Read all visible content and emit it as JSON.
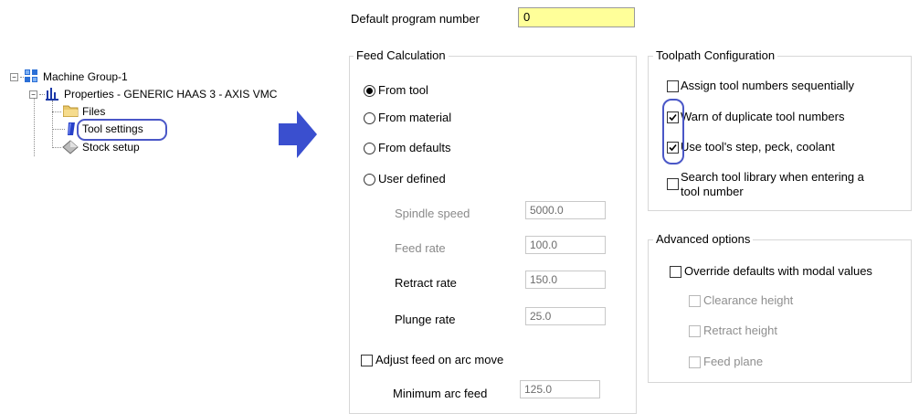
{
  "tree": {
    "machine_group": "Machine Group-1",
    "properties": "Properties - GENERIC HAAS 3 - AXIS VMC",
    "files": "Files",
    "tool_settings": "Tool settings",
    "stock_setup": "Stock setup"
  },
  "default_program": {
    "label": "Default program number",
    "value": "0"
  },
  "feed_calc": {
    "title": "Feed Calculation",
    "options": [
      "From tool",
      "From material",
      "From defaults",
      "User defined"
    ],
    "selected": "From tool",
    "spindle_speed": {
      "label": "Spindle speed",
      "value": "5000.0"
    },
    "feed_rate": {
      "label": "Feed rate",
      "value": "100.0"
    },
    "retract_rate": {
      "label": "Retract rate",
      "value": "150.0"
    },
    "plunge_rate": {
      "label": "Plunge rate",
      "value": "25.0"
    },
    "adjust_feed_arc": {
      "label": "Adjust feed on arc move",
      "checked": false
    },
    "min_arc_feed": {
      "label": "Minimum arc feed",
      "value": "125.0"
    }
  },
  "toolpath_config": {
    "title": "Toolpath Configuration",
    "assign_seq": {
      "label": "Assign tool numbers sequentially",
      "checked": false
    },
    "warn_dup": {
      "label": "Warn of duplicate tool numbers",
      "checked": true
    },
    "use_step": {
      "label": "Use tool's step, peck, coolant",
      "checked": true
    },
    "search_lib": {
      "label_line1": "Search tool library when entering a",
      "label_line2": "tool number",
      "checked": false
    }
  },
  "advanced": {
    "title": "Advanced options",
    "override": {
      "label": "Override defaults with modal values",
      "checked": false
    },
    "clearance": "Clearance height",
    "retract": "Retract height",
    "feed_plane": "Feed plane"
  },
  "colors": {
    "highlight_ring": "#4a57c7",
    "arrow": "#3a4fcf",
    "input_yellow": "#ffff99"
  }
}
